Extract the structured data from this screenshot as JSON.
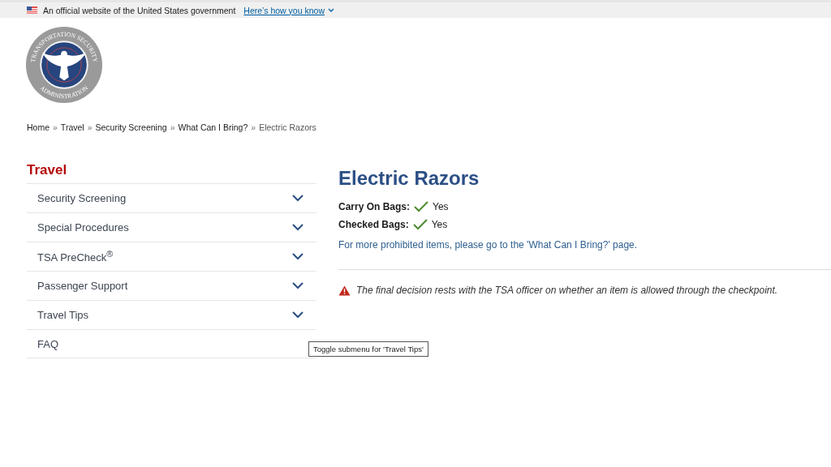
{
  "banner": {
    "text": "An official website of the United States government",
    "link": "Here’s how you know"
  },
  "logo": {
    "text_top": "TRANSPORTATION SECURITY",
    "text_bottom": "ADMINISTRATION"
  },
  "breadcrumb": {
    "separator": "»",
    "items": [
      {
        "label": "Home",
        "current": false
      },
      {
        "label": "Travel",
        "current": false
      },
      {
        "label": "Security Screening",
        "current": false
      },
      {
        "label": "What Can I Bring?",
        "current": false
      },
      {
        "label": "Electric Razors",
        "current": true
      }
    ]
  },
  "sidebar": {
    "title": "Travel",
    "items": [
      {
        "label": "Security Screening",
        "has_submenu": true
      },
      {
        "label": "Special Procedures",
        "has_submenu": true
      },
      {
        "label": "TSA PreCheck$^{®}$",
        "has_submenu": true
      },
      {
        "label": "Passenger Support",
        "has_submenu": true
      },
      {
        "label": "Travel Tips",
        "has_submenu": true
      },
      {
        "label": "FAQ",
        "has_submenu": false
      }
    ]
  },
  "main": {
    "title": "Electric Razors",
    "bags": [
      {
        "label": "Carry On Bags:",
        "allowed": true,
        "value": "Yes"
      },
      {
        "label": "Checked Bags:",
        "allowed": true,
        "value": "Yes"
      }
    ],
    "more_link": "For more prohibited items, please go to the 'What Can I Bring?' page.",
    "notice": "The final decision rests with the TSA officer on whether an item is allowed through the checkpoint."
  },
  "tooltip": {
    "text": "Toggle submenu for 'Travel Tips'"
  }
}
